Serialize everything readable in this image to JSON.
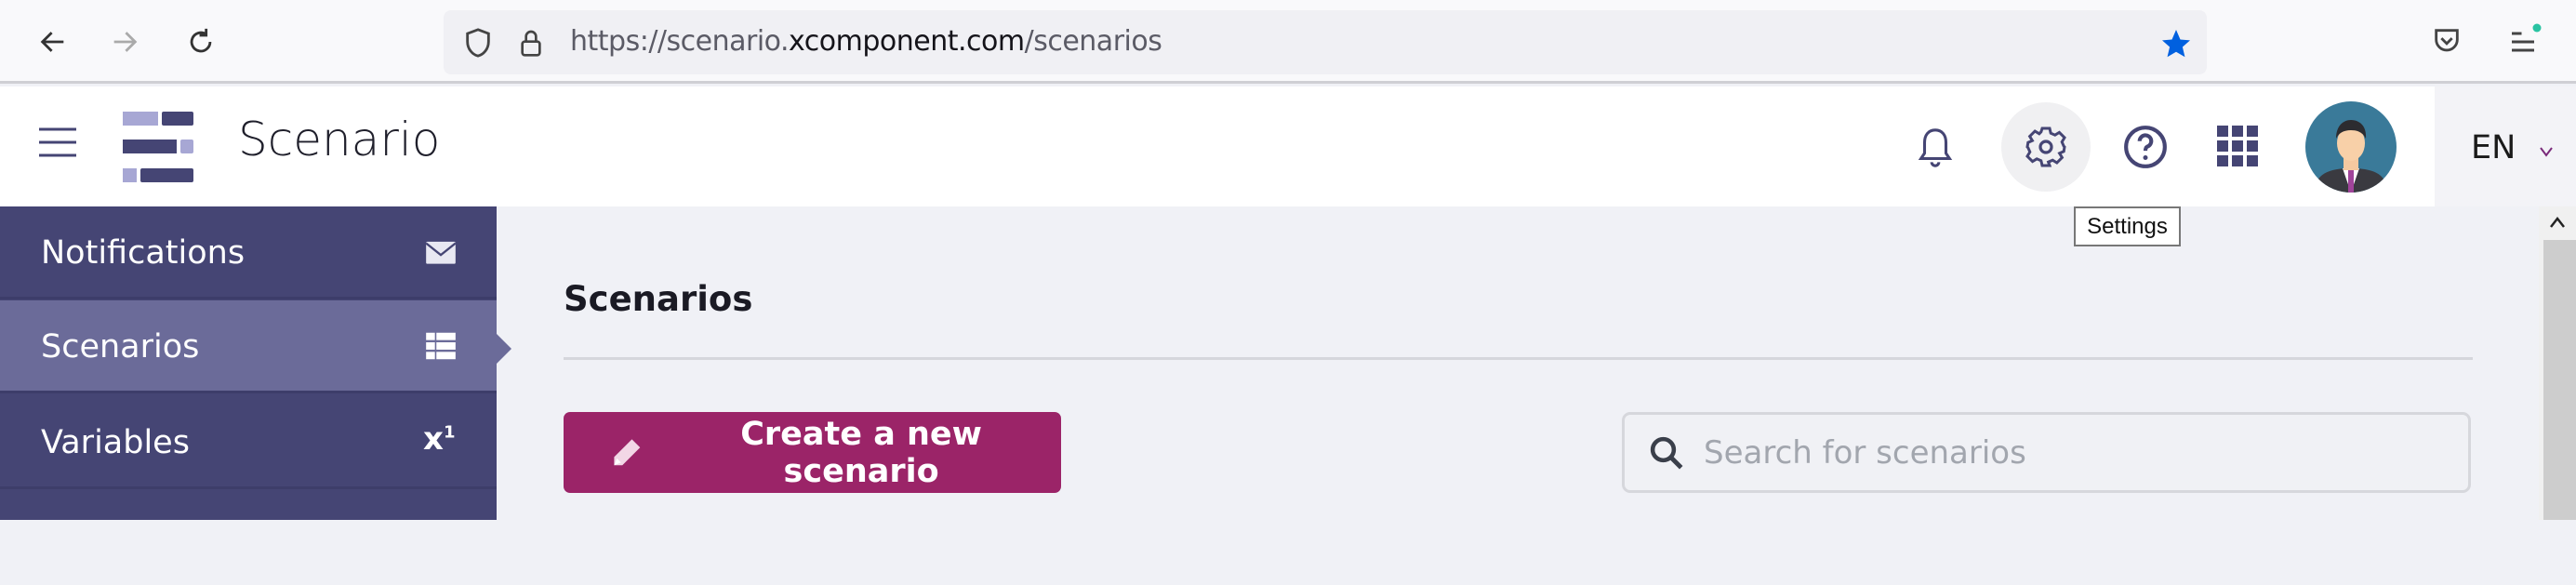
{
  "browser": {
    "url_prefix": "https://scenario.",
    "url_domain": "xcomponent.com",
    "url_path": "/scenarios",
    "bookmark_color": "#0060df"
  },
  "header": {
    "title": "Scenario",
    "language": "EN",
    "tooltip": "Settings"
  },
  "sidebar": {
    "items": [
      {
        "label": "Notifications",
        "icon": "envelope-icon",
        "active": false
      },
      {
        "label": "Scenarios",
        "icon": "table-list-icon",
        "active": true
      },
      {
        "label": "Variables",
        "icon": "superscript-icon",
        "active": false
      }
    ]
  },
  "main": {
    "title": "Scenarios",
    "create_button": "Create a new scenario",
    "search_placeholder": "Search for scenarios"
  },
  "colors": {
    "sidebar": "#454574",
    "sidebar_active": "#6b6b99",
    "primary_button": "#9b2468"
  }
}
